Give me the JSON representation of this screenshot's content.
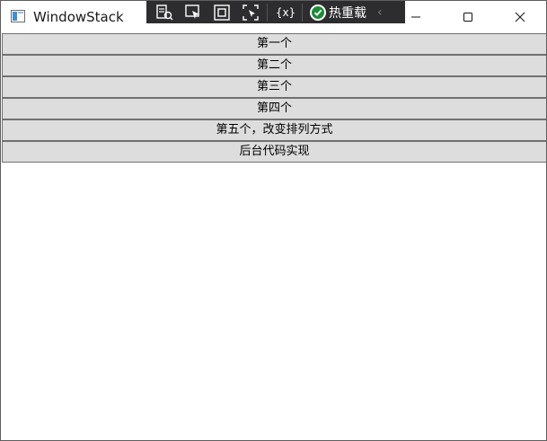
{
  "window": {
    "title": "WindowStack"
  },
  "toolbar": {
    "icons": [
      "live-visual-tree-icon",
      "select-element-icon",
      "display-layout-adorners-icon",
      "track-focus-icon",
      "binding-failures-icon"
    ],
    "hot_reload_label": "热重载"
  },
  "buttons": [
    {
      "label": "第一个"
    },
    {
      "label": "第二个"
    },
    {
      "label": "第三个"
    },
    {
      "label": "第四个"
    },
    {
      "label": "第五个，改变排列方式"
    },
    {
      "label": "后台代码实现"
    }
  ]
}
